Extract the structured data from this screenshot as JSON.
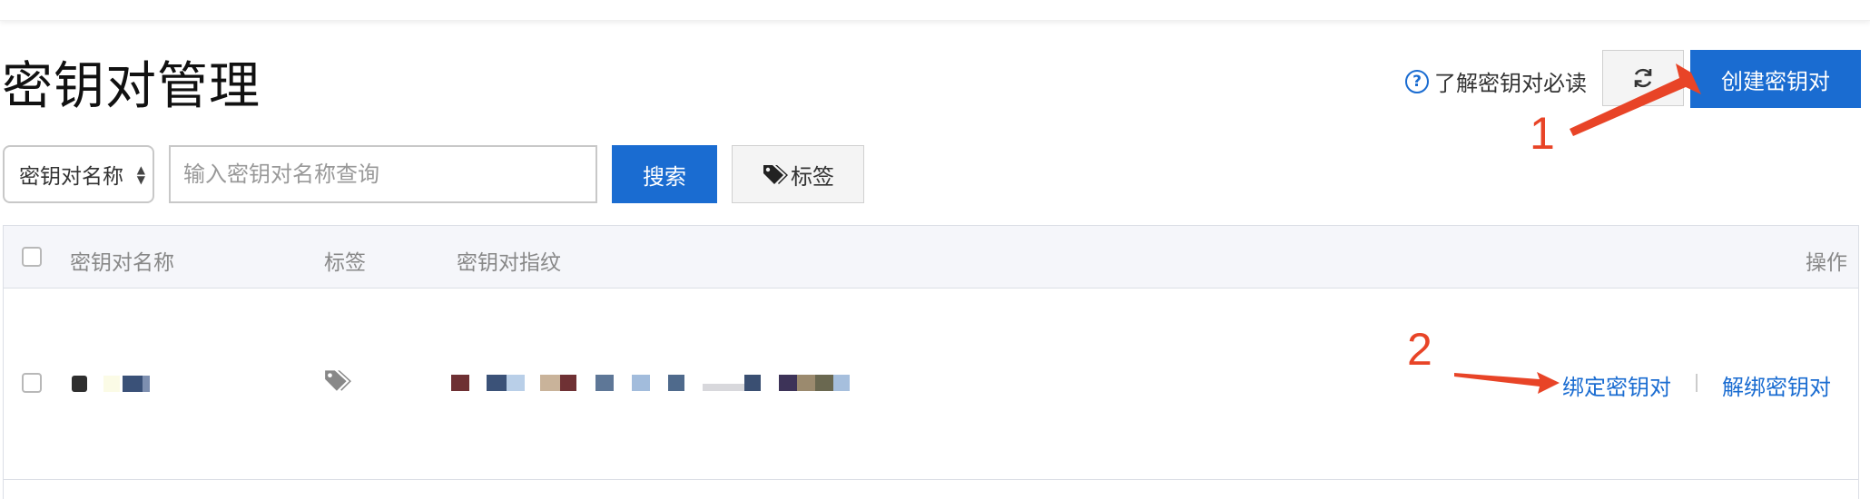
{
  "page": {
    "title": "密钥对管理"
  },
  "header": {
    "help_link": "了解密钥对必读",
    "create_button": "创建密钥对"
  },
  "search": {
    "field_select": "密钥对名称",
    "placeholder": "输入密钥对名称查询",
    "search_button": "搜索",
    "tag_button": "标签"
  },
  "table": {
    "columns": [
      "密钥对名称",
      "标签",
      "密钥对指纹",
      "操作"
    ],
    "rows": [
      {
        "actions": [
          "绑定密钥对",
          "解绑密钥对"
        ]
      }
    ]
  },
  "annotations": [
    "1",
    "2"
  ],
  "colors": {
    "primary": "#1a6cd1",
    "annotation": "#e84427",
    "header_bg": "#f5f6fa"
  },
  "icons": [
    "question-circle-icon",
    "refresh-icon",
    "tag-icon",
    "caret-updown-icon"
  ]
}
